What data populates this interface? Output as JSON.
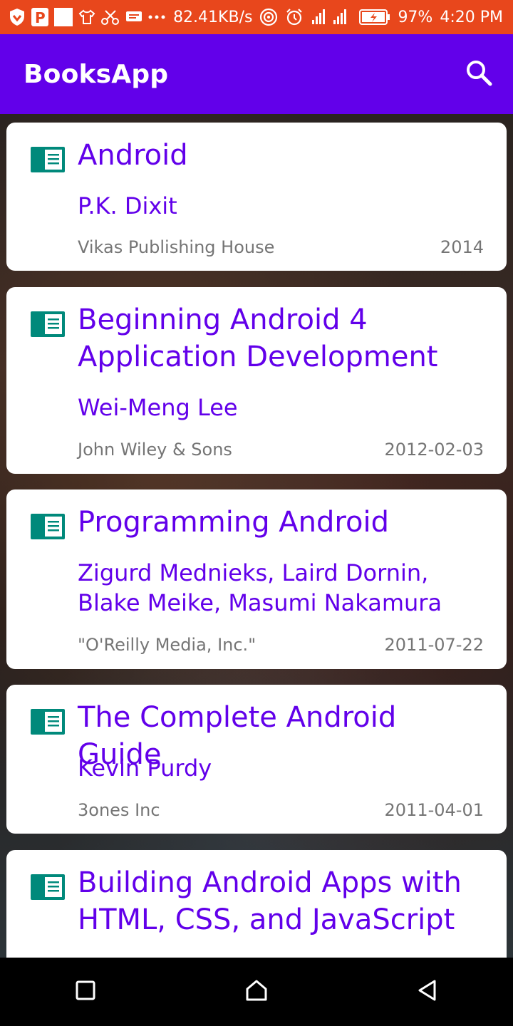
{
  "status_bar": {
    "network_speed": "82.41KB/s",
    "battery": "97%",
    "time": "4:20 PM",
    "background": "#e8471c"
  },
  "app_bar": {
    "title": "BooksApp",
    "background": "#6200ea",
    "search_icon": "search-icon"
  },
  "books": [
    {
      "title": "Android",
      "author": "P.K. Dixit",
      "publisher": "Vikas Publishing House",
      "date": "2014"
    },
    {
      "title": "Beginning Android 4 Application Development",
      "author": "Wei-Meng Lee",
      "publisher": "John Wiley & Sons",
      "date": "2012-02-03"
    },
    {
      "title": "Programming Android",
      "author": "Zigurd Mednieks, Laird Dornin, Blake Meike, Masumi Nakamura",
      "publisher": "\"O'Reilly Media, Inc.\"",
      "date": "2011-07-22"
    },
    {
      "title": "The Complete Android Guide",
      "author": "Kevin Purdy",
      "publisher": "3ones Inc",
      "date": "2011-04-01"
    },
    {
      "title": "Building Android Apps with HTML, CSS, and JavaScript",
      "author": "",
      "publisher": "",
      "date": ""
    }
  ],
  "colors": {
    "accent": "#6200ea",
    "book_icon": "#00897b",
    "secondary_text": "#757575"
  },
  "nav_bar": {
    "recents_icon": "recents-icon",
    "home_icon": "home-icon",
    "back_icon": "back-icon"
  }
}
